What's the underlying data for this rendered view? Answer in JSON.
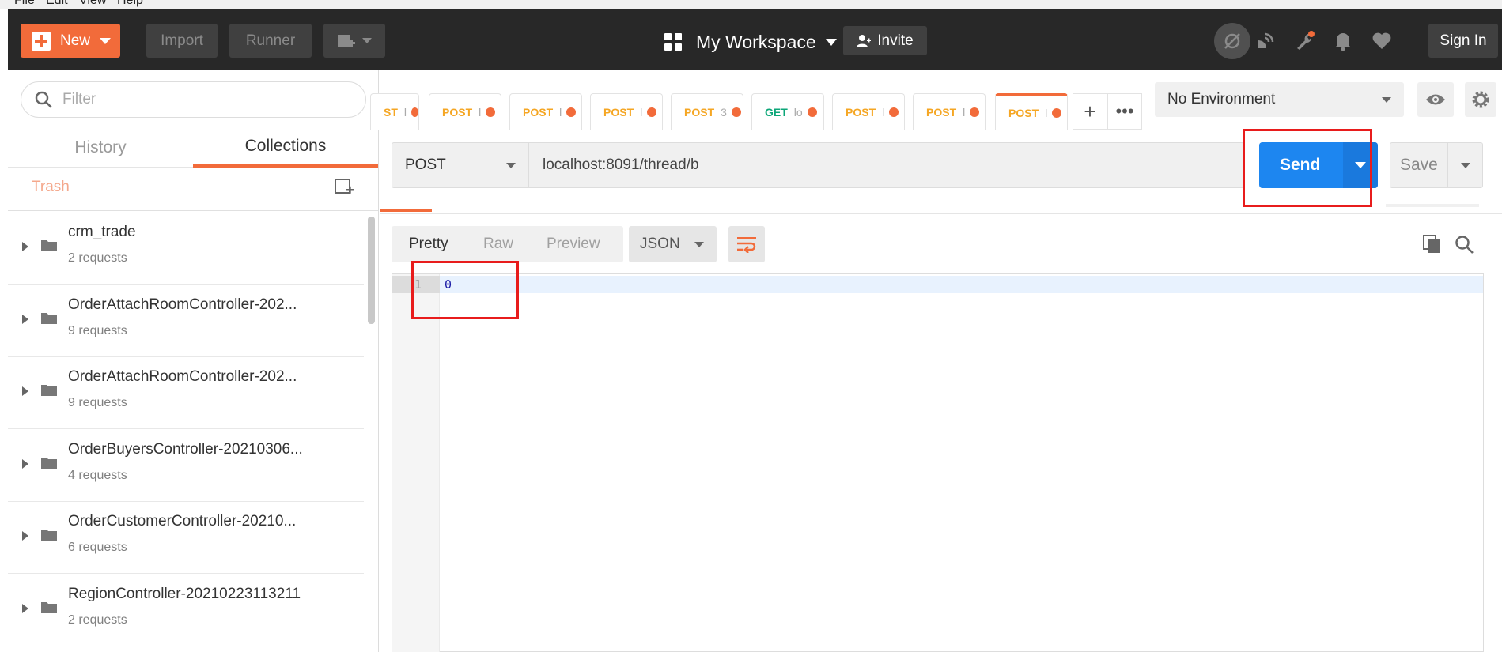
{
  "menu": [
    "File",
    "Edit",
    "View",
    "Help"
  ],
  "header": {
    "new_label": "New",
    "import_label": "Import",
    "runner_label": "Runner",
    "workspace_label": "My Workspace",
    "invite_label": "Invite",
    "signin_label": "Sign In",
    "icons": [
      "sync-off-icon",
      "satellite-icon",
      "wrench-icon",
      "bell-icon",
      "heart-icon"
    ],
    "accent": "#f26b3a"
  },
  "sidebar": {
    "filter_placeholder": "Filter",
    "tabs": [
      "History",
      "Collections"
    ],
    "active_tab": "Collections",
    "trash_label": "Trash",
    "collections": [
      {
        "name": "crm_trade",
        "count": "2 requests"
      },
      {
        "name": "OrderAttachRoomController-202...",
        "count": "9 requests"
      },
      {
        "name": "OrderAttachRoomController-202...",
        "count": "9 requests"
      },
      {
        "name": "OrderBuyersController-20210306...",
        "count": "4 requests"
      },
      {
        "name": "OrderCustomerController-20210...",
        "count": "6 requests"
      },
      {
        "name": "RegionController-20210223113211",
        "count": "2 requests"
      }
    ]
  },
  "request_tabs": [
    {
      "method": "ST",
      "url": "l"
    },
    {
      "method": "POST",
      "url": "l"
    },
    {
      "method": "POST",
      "url": "l"
    },
    {
      "method": "POST",
      "url": "l"
    },
    {
      "method": "POST",
      "url": "3"
    },
    {
      "method": "GET",
      "url": "lo"
    },
    {
      "method": "POST",
      "url": "l"
    },
    {
      "method": "POST",
      "url": "l"
    },
    {
      "method": "POST",
      "url": "l"
    }
  ],
  "environment": {
    "selected": "No Environment"
  },
  "request": {
    "method": "POST",
    "url": "localhost:8091/thread/b",
    "send_label": "Send",
    "save_label": "Save"
  },
  "response": {
    "view_tabs": [
      "Pretty",
      "Raw",
      "Preview"
    ],
    "active_view": "Pretty",
    "format": "JSON",
    "lines": [
      {
        "num": "1",
        "text": "0"
      }
    ]
  },
  "colors": {
    "send": "#1d86f0",
    "highlight": "#e81c1c",
    "post": "#f5a623",
    "get": "#0ca678"
  }
}
